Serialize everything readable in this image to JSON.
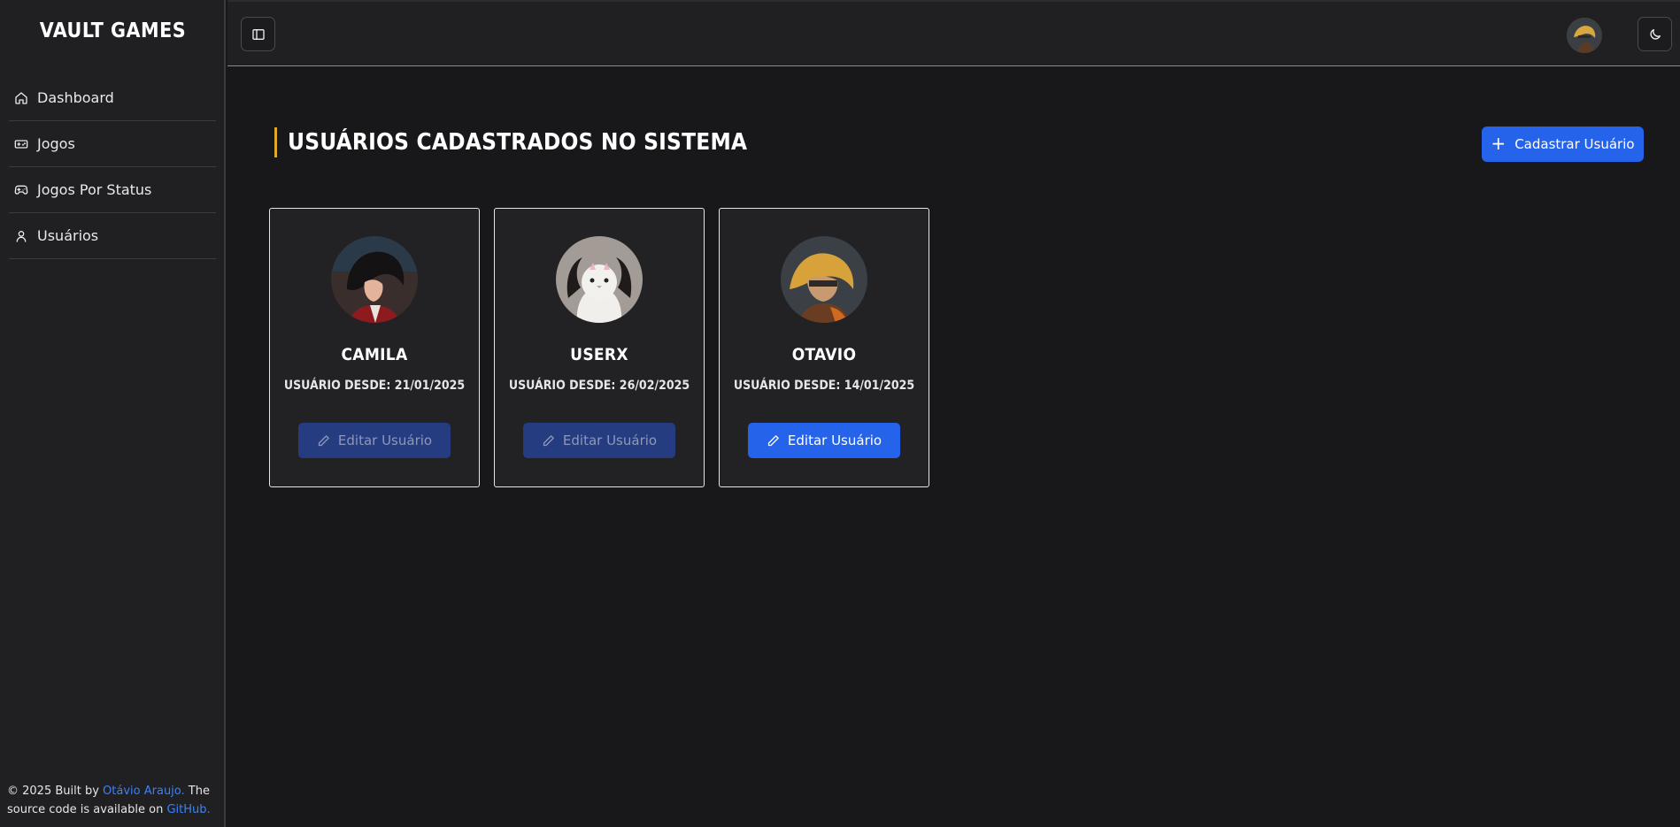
{
  "app": {
    "brand": "VAULT GAMES"
  },
  "sidebar": {
    "items": [
      {
        "label": "Dashboard",
        "icon": "home-icon"
      },
      {
        "label": "Jogos",
        "icon": "gamepad-icon"
      },
      {
        "label": "Jogos Por Status",
        "icon": "controller-icon"
      },
      {
        "label": "Usuários",
        "icon": "user-icon"
      }
    ],
    "footer": {
      "prefix": "© 2025 Built by ",
      "author": "Otávio Araujo.",
      "middle": " The source code is available on ",
      "link": "GitHub."
    }
  },
  "topbar": {
    "toggle_icon": "sidebar-toggle-icon",
    "theme_icon": "moon-icon"
  },
  "main": {
    "title": "USUÁRIOS CADASTRADOS NO SISTEMA",
    "add_button": "Cadastrar Usuário",
    "users": [
      {
        "name": "CAMILA",
        "since": "USUÁRIO DESDE: 21/01/2025",
        "edit_label": "Editar Usuário",
        "edit_enabled": false
      },
      {
        "name": "USERX",
        "since": "USUÁRIO DESDE: 26/02/2025",
        "edit_label": "Editar Usuário",
        "edit_enabled": false
      },
      {
        "name": "OTAVIO",
        "since": "USUÁRIO DESDE: 14/01/2025",
        "edit_label": "Editar Usuário",
        "edit_enabled": true
      }
    ]
  },
  "colors": {
    "accent": "#2563eb",
    "title_bar": "#e0a92c",
    "background": "#18181a"
  }
}
